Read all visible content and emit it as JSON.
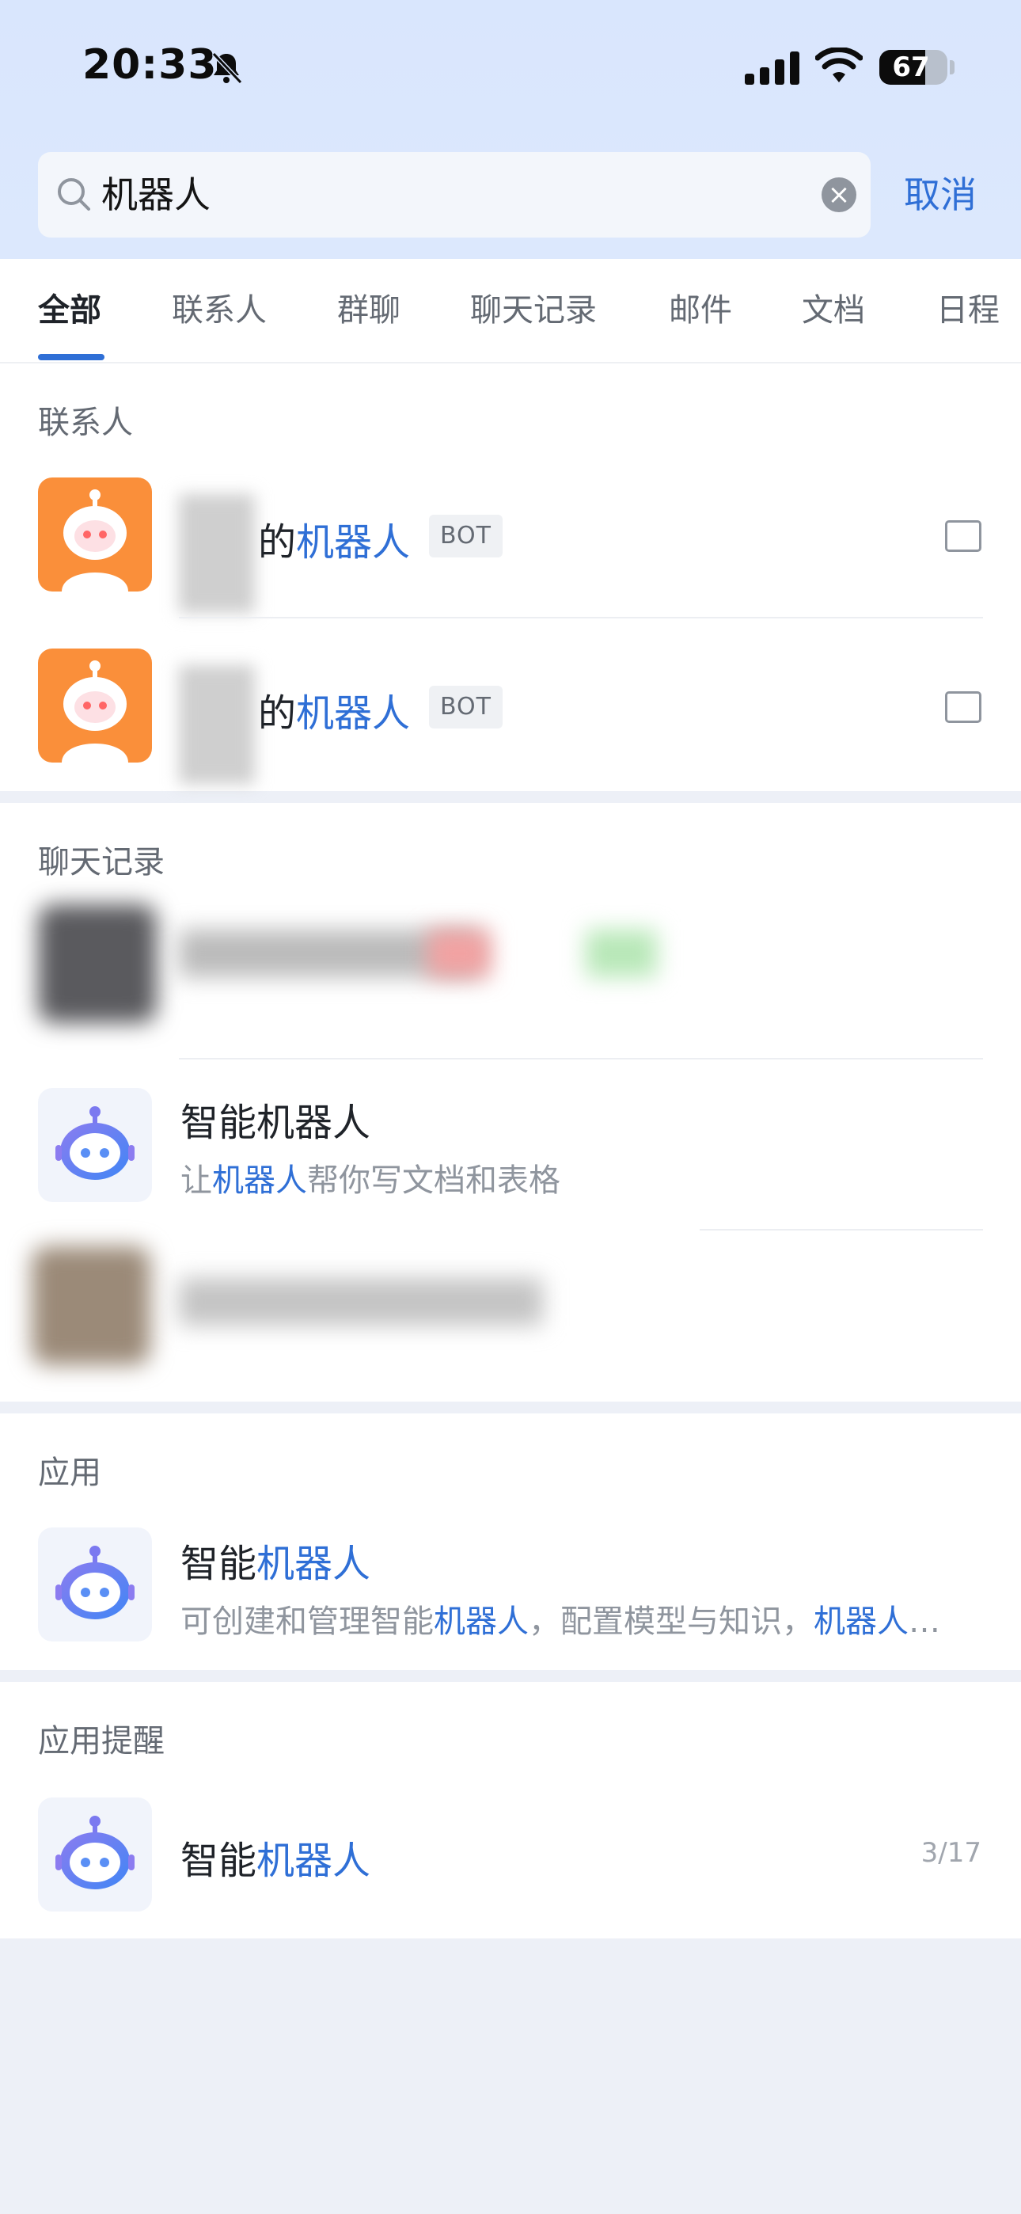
{
  "status_bar": {
    "time": "20:33",
    "battery": "67",
    "battery_level": 0.67,
    "icons": [
      "bell-slash-icon",
      "cellular-signal-icon",
      "wifi-icon",
      "battery-icon"
    ]
  },
  "search": {
    "query": "机器人",
    "cancel_label": "取消"
  },
  "tabs": [
    "全部",
    "联系人",
    "群聊",
    "聊天记录",
    "邮件",
    "文档",
    "日程"
  ],
  "active_tab": "全部",
  "contacts": {
    "title": "联系人",
    "items": [
      {
        "name_suffix": "的",
        "name_highlight": "机器人",
        "badge": "BOT"
      },
      {
        "name_suffix": "的",
        "name_highlight": "机器人",
        "badge": "BOT"
      }
    ]
  },
  "chat_records": {
    "title": "聊天记录",
    "item": {
      "title": "智能机器人",
      "sub_prefix": "让",
      "sub_highlight": "机器人",
      "sub_suffix": "帮你写文档和表格"
    }
  },
  "apps": {
    "title": "应用",
    "item": {
      "title_prefix": "智能",
      "title_highlight": "机器人",
      "sub_part1": "可创建和管理智能",
      "sub_hl1": "机器人",
      "sub_part2": "，配置模型与知识，",
      "sub_hl2": "机器人",
      "sub_ellipsis": "…"
    }
  },
  "app_reminders": {
    "title": "应用提醒",
    "item": {
      "title_prefix": "智能",
      "title_highlight": "机器人",
      "date": "3/17"
    }
  },
  "colors": {
    "accent": "#2f6fd6",
    "header_bg": "#dce8fd",
    "orange_avatar": "#fa8f3a"
  }
}
